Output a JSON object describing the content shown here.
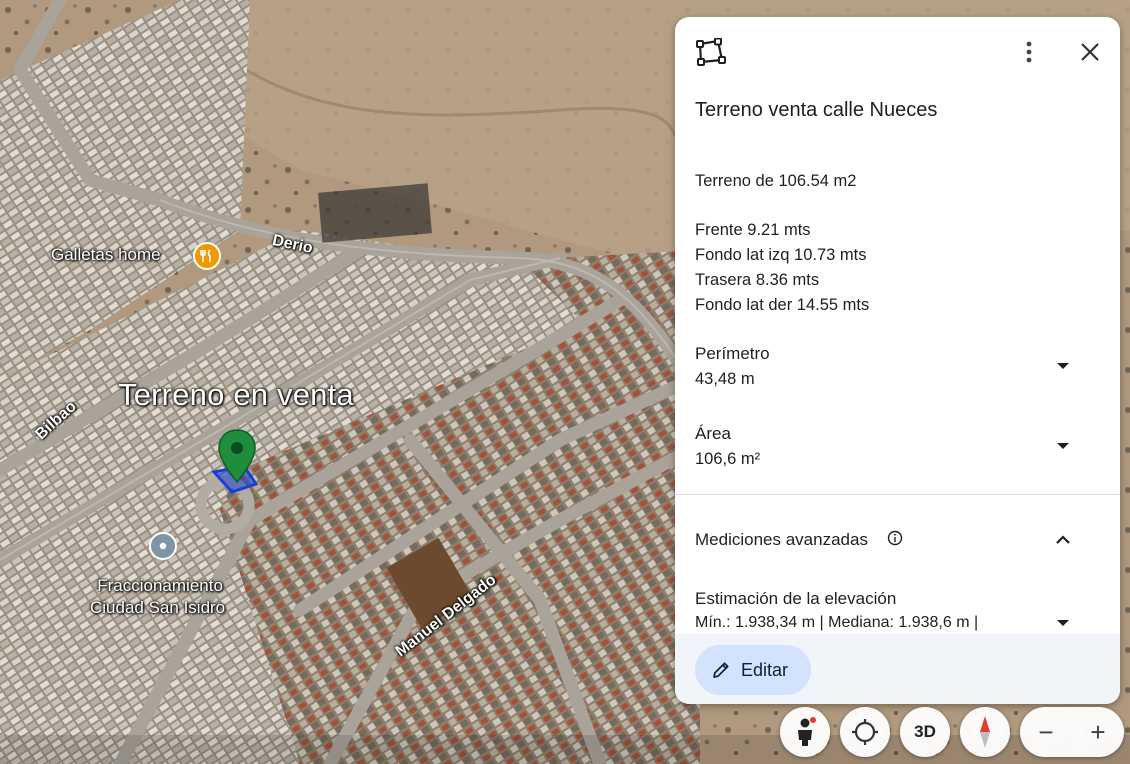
{
  "map": {
    "streets": {
      "derio": "Derio",
      "bilbao": "Bilbao",
      "manuel_delgado": "Manuel Delgado"
    },
    "pois": {
      "galletas": "Galletas home",
      "fraccionamiento_line1": "Fraccionamiento",
      "fraccionamiento_line2": "Ciudad San Isidro"
    },
    "placemark_label": "Terreno en venta",
    "colors": {
      "placemark": "#1e8e3e",
      "polygon": "#1a3fd6",
      "poi_food": "#f29900",
      "poi_generic": "#8aa3b5"
    }
  },
  "panel": {
    "title": "Terreno venta calle Nueces",
    "description": {
      "line1": "Terreno de 106.54 m2",
      "line2": "Frente 9.21 mts",
      "line3": "Fondo lat izq 10.73 mts",
      "line4": "Trasera 8.36 mts",
      "line5": "Fondo lat der 14.55 mts"
    },
    "perimeter": {
      "label": "Perímetro",
      "value": "43,48 m"
    },
    "area": {
      "label": "Área",
      "value": "106,6 m²"
    },
    "advanced": {
      "label": "Mediciones avanzadas"
    },
    "elevation": {
      "label": "Estimación de la elevación",
      "value": "Mín.: 1.938,34 m | Mediana: 1.938,6 m |"
    },
    "edit_label": "Editar"
  },
  "controls": {
    "three_d": "3D",
    "zoom_out": "−",
    "zoom_in": "+"
  }
}
